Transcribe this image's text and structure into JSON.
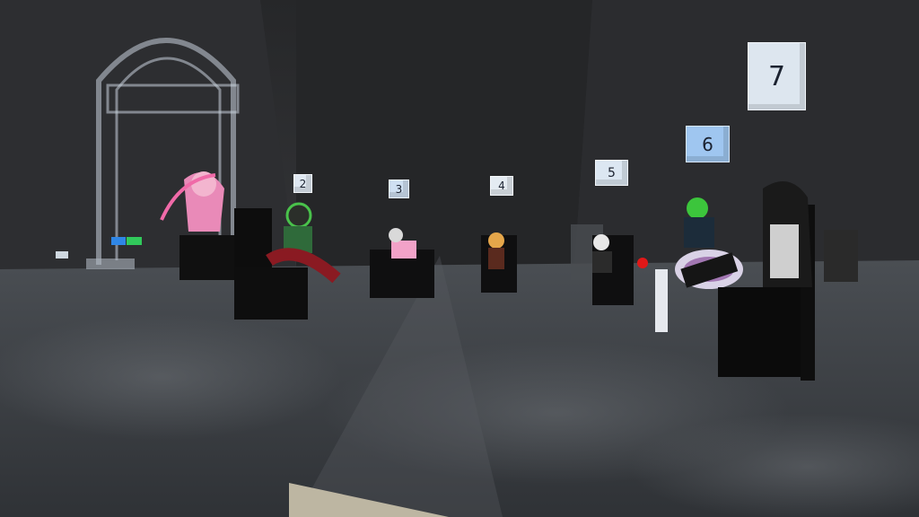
{
  "scene": {
    "description_colors": {
      "wall": "#2a2b2d",
      "floor": "#3c3f43",
      "cube_face": "#dfe8f2",
      "cube_highlight": "#6fa6e0"
    }
  },
  "seat_markers": [
    {
      "label": "2"
    },
    {
      "label": "3"
    },
    {
      "label": "4"
    },
    {
      "label": "5"
    },
    {
      "label": "6"
    },
    {
      "label": "7"
    }
  ]
}
